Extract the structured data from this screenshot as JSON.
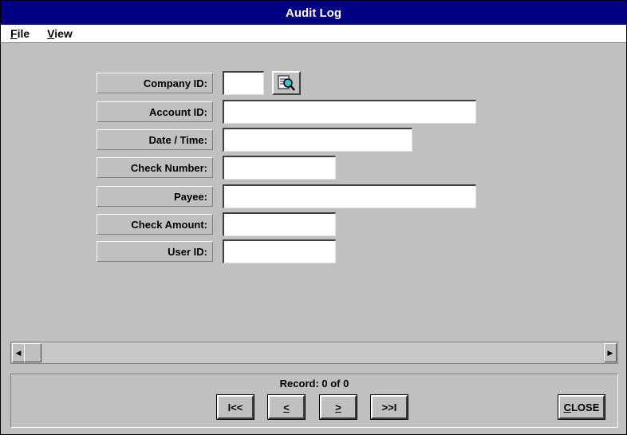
{
  "window": {
    "title": "Audit Log"
  },
  "menu": {
    "items": [
      {
        "label": "File",
        "accel": "F",
        "rest": "ile"
      },
      {
        "label": "View",
        "accel": "V",
        "rest": "iew"
      }
    ]
  },
  "form": {
    "fields": [
      {
        "label": "Company ID:",
        "value": "",
        "name": "company-id"
      },
      {
        "label": "Account ID:",
        "value": "",
        "name": "account-id"
      },
      {
        "label": "Date / Time:",
        "value": "",
        "name": "date-time"
      },
      {
        "label": "Check Number:",
        "value": "",
        "name": "check-number"
      },
      {
        "label": "Payee:",
        "value": "",
        "name": "payee"
      },
      {
        "label": "Check Amount:",
        "value": "",
        "name": "check-amount"
      },
      {
        "label": "User ID:",
        "value": "",
        "name": "user-id"
      }
    ],
    "lookup_icon": "magnifier-document-icon"
  },
  "scrollbar": {
    "left_arrow": "◀",
    "right_arrow": "▶"
  },
  "navigation": {
    "record_text": "Record: 0 of 0",
    "first_label": "I<<",
    "prev_label": "<",
    "next_label": ">",
    "last_label": ">>I",
    "close_label": "CLOSE",
    "close_accel": "C",
    "close_rest": "LOSE"
  },
  "colors": {
    "title_bar": "#000080",
    "face": "#c0c0c0",
    "input_bg": "#ffffff"
  }
}
